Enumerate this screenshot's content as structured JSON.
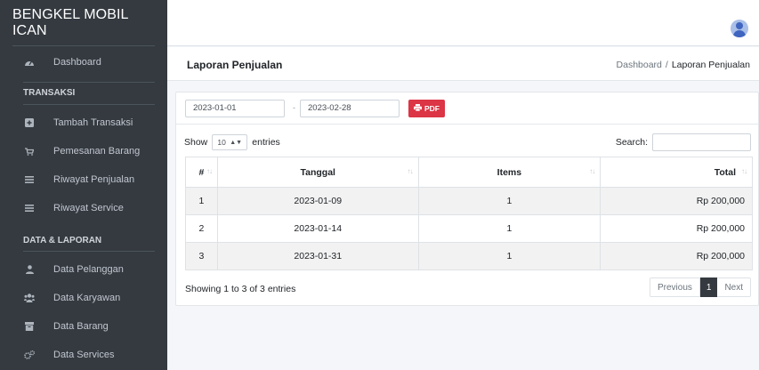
{
  "brand": "BENGKEL MOBIL ICAN",
  "sidebar": {
    "dashboard": "Dashboard",
    "section_transaksi": "TRANSAKSI",
    "transaksi_items": [
      {
        "label": "Tambah Transaksi",
        "icon": "plus-square-icon"
      },
      {
        "label": "Pemesanan Barang",
        "icon": "cart-icon"
      },
      {
        "label": "Riwayat Penjualan",
        "icon": "list-icon"
      },
      {
        "label": "Riwayat Service",
        "icon": "list-icon"
      }
    ],
    "section_data": "DATA & LAPORAN",
    "data_items": [
      {
        "label": "Data Pelanggan",
        "icon": "user-icon"
      },
      {
        "label": "Data Karyawan",
        "icon": "users-icon"
      },
      {
        "label": "Data Barang",
        "icon": "box-icon"
      },
      {
        "label": "Data Services",
        "icon": "cogs-icon"
      }
    ]
  },
  "header": {
    "title": "Laporan Penjualan",
    "breadcrumb": [
      "Dashboard",
      "Laporan Penjualan"
    ]
  },
  "filter": {
    "date_from": "2023-01-01",
    "date_separator": "-",
    "date_to": "2023-02-28",
    "pdf_label": "PDF"
  },
  "table_controls": {
    "show_label": "Show",
    "length_value": "10",
    "entries_label": "entries",
    "search_label": "Search:"
  },
  "table": {
    "columns": [
      "#",
      "Tanggal",
      "Items",
      "Total"
    ],
    "rows": [
      {
        "no": "1",
        "tanggal": "2023-01-09",
        "items": "1",
        "total": "Rp 200,000"
      },
      {
        "no": "2",
        "tanggal": "2023-01-14",
        "items": "1",
        "total": "Rp 200,000"
      },
      {
        "no": "3",
        "tanggal": "2023-01-31",
        "items": "1",
        "total": "Rp 200,000"
      }
    ]
  },
  "footer": {
    "info": "Showing 1 to 3 of 3 entries",
    "prev": "Previous",
    "current_page": "1",
    "next": "Next"
  },
  "colors": {
    "sidebar_bg": "#343a40",
    "pdf_button": "#dc3545",
    "active_page": "#343a40"
  }
}
